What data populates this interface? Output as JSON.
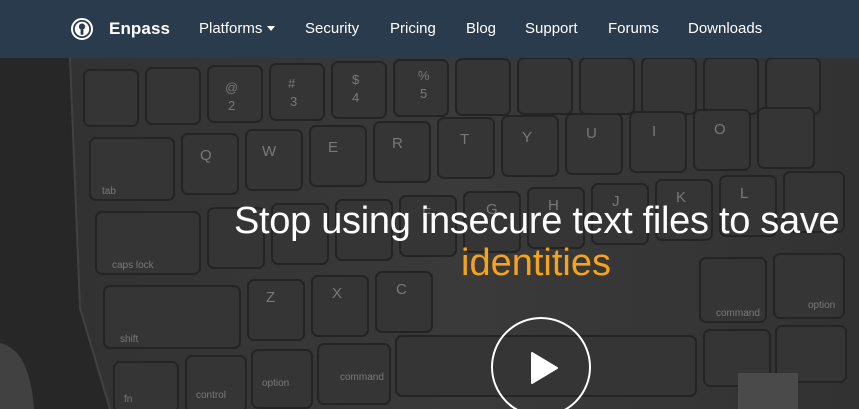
{
  "nav": {
    "brand": "Enpass",
    "items": [
      {
        "label": "Platforms",
        "has_dropdown": true
      },
      {
        "label": "Security"
      },
      {
        "label": "Pricing"
      },
      {
        "label": "Blog"
      },
      {
        "label": "Support"
      },
      {
        "label": "Forums"
      },
      {
        "label": "Downloads"
      }
    ]
  },
  "hero": {
    "headline": "Stop using insecure text files to save",
    "headline_accent": "identities",
    "play_icon": "play-icon"
  },
  "colors": {
    "navbar_bg": "#2b3b4e",
    "accent": "#f5a21c",
    "text": "#ffffff"
  }
}
